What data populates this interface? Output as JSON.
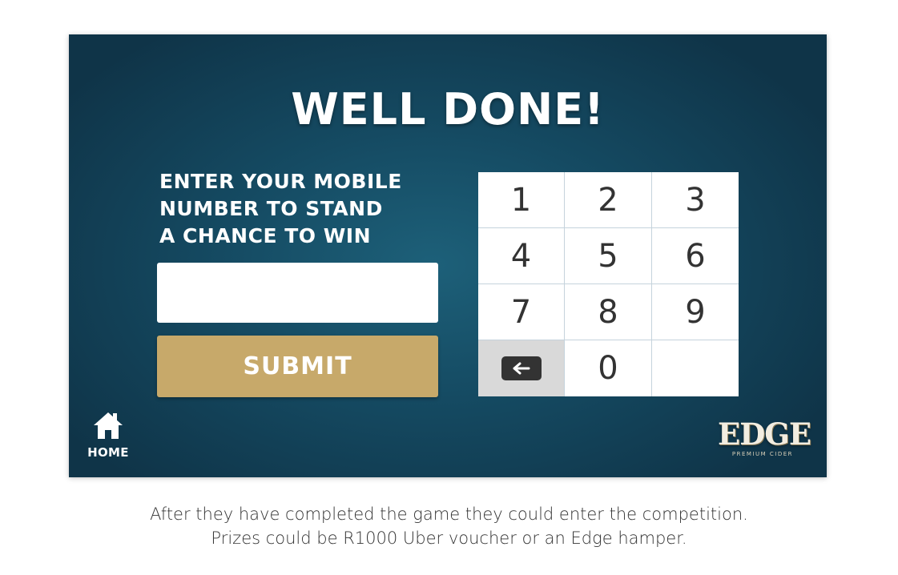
{
  "screen": {
    "title": "WELL DONE!",
    "prompt_lines": [
      "ENTER YOUR MOBILE",
      "NUMBER TO STAND",
      "A CHANCE TO WIN"
    ],
    "phone_input": {
      "value": "",
      "placeholder": ""
    },
    "submit_label": "SUBMIT",
    "keypad": {
      "keys": [
        "1",
        "2",
        "3",
        "4",
        "5",
        "6",
        "7",
        "8",
        "9",
        "0"
      ],
      "backspace_icon": "backspace-arrow-icon"
    },
    "home": {
      "icon": "home-icon",
      "label": "HOME"
    },
    "logo": {
      "name": "EDGE",
      "tagline": "PREMIUM CIDER"
    }
  },
  "caption_lines": [
    "After they have completed the game they could enter the competition.",
    "Prizes could be R1000 Uber voucher or an Edge hamper."
  ],
  "colors": {
    "background": "#154b63",
    "submit": "#c7a96a",
    "keypad_background": "#ffffff",
    "backspace_key": "#d9d9d9"
  }
}
